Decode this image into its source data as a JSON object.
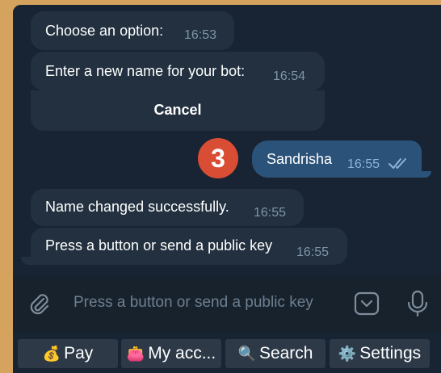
{
  "messages": [
    {
      "text": "Choose an option:",
      "time": "16:53"
    },
    {
      "text": "Enter a new name for your bot:",
      "time": "16:54"
    },
    {
      "text": "Sandrisha",
      "time": "16:55"
    },
    {
      "text": "Name changed successfully.",
      "time": "16:55"
    },
    {
      "text": "Press a button or send a public key",
      "time": "16:55"
    }
  ],
  "inline_button": {
    "label": "Cancel"
  },
  "annotation": {
    "number": "3"
  },
  "composer": {
    "placeholder": "Press a button or send a public key"
  },
  "keyboard": [
    {
      "icon": "💰",
      "label": "Pay"
    },
    {
      "icon": "👛",
      "label": "My acc..."
    },
    {
      "icon": "🔍",
      "label": "Search"
    },
    {
      "icon": "⚙️",
      "label": "Settings"
    }
  ],
  "colors": {
    "chat_background": "#182433",
    "incoming_bubble": "#22303f",
    "outgoing_bubble": "#2b5278",
    "annotation_badge": "#d84d34",
    "outer_background": "#d6a35f"
  },
  "icons": [
    "paperclip-icon",
    "keyboard-icon",
    "microphone-icon",
    "double-check-icon"
  ]
}
